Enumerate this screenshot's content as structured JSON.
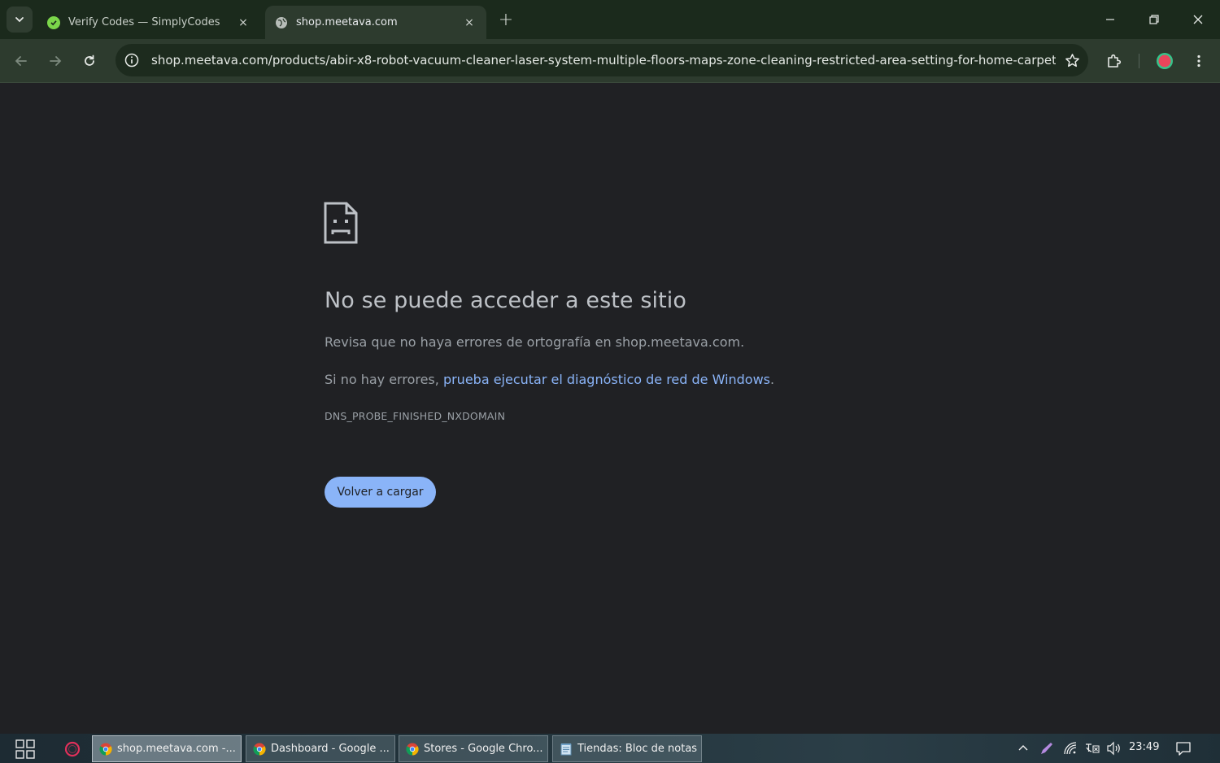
{
  "browser": {
    "tabs": [
      {
        "title": "Verify Codes — SimplyCodes",
        "close_glyph": "×",
        "active": false
      },
      {
        "title": "shop.meetava.com",
        "close_glyph": "×",
        "active": true
      }
    ],
    "new_tab_glyph": "+",
    "url": "shop.meetava.com/products/abir-x8-robot-vacuum-cleaner-laser-system-multiple-floors-maps-zone-cleaning-restricted-area-setting-for-home-carpet-...",
    "colors": {
      "frame": "#1b2a1c",
      "toolbar": "#2d3b2e",
      "profile": "#e8455b"
    }
  },
  "error_page": {
    "title": "No se puede acceder a este sitio",
    "line1": "Revisa que no haya errores de ortografía en shop.meetava.com.",
    "line2_prefix": "Si no hay errores, ",
    "line2_link": "prueba ejecutar el diagnóstico de red de Windows",
    "line2_suffix": ".",
    "error_code": "DNS_PROBE_FINISHED_NXDOMAIN",
    "reload_label": "Volver a cargar",
    "colors": {
      "link": "#8ab4f8",
      "button": "#8ab4f8",
      "background": "#202124"
    }
  },
  "taskbar": {
    "apps": [
      {
        "label": "shop.meetava.com -...",
        "icon": "chrome-icon",
        "active": true
      },
      {
        "label": "Dashboard - Google ...",
        "icon": "chrome-icon",
        "active": false
      },
      {
        "label": "Stores - Google Chro...",
        "icon": "chrome-icon",
        "active": false
      },
      {
        "label": "Tiendas: Bloc de notas",
        "icon": "notepad-icon",
        "active": false
      }
    ],
    "clock": "23:49"
  }
}
